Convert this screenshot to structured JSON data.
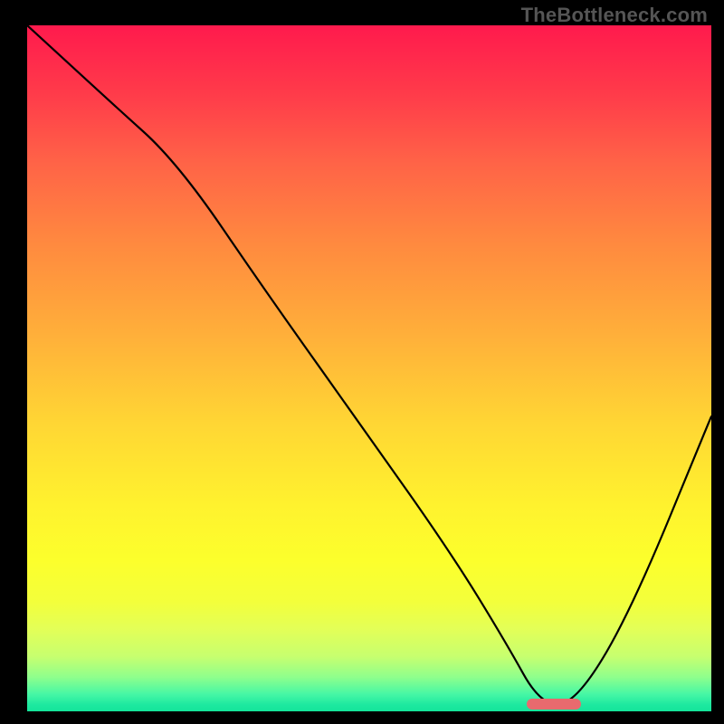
{
  "watermark": "TheBottleneck.com",
  "chart_data": {
    "type": "line",
    "title": "",
    "xlabel": "",
    "ylabel": "",
    "xlim": [
      0,
      100
    ],
    "ylim": [
      0,
      100
    ],
    "background_gradient": {
      "top_color": "#ff1a4d",
      "mid_color": "#ffd634",
      "bottom_color": "#14e49a",
      "meaning": "red=high bottleneck, green=optimal"
    },
    "series": [
      {
        "name": "bottleneck-curve",
        "x": [
          0,
          12,
          22,
          35,
          50,
          62,
          70,
          75,
          80,
          88,
          100
        ],
        "y": [
          100,
          89,
          80,
          61,
          40,
          23,
          10,
          1,
          1,
          14,
          43
        ]
      }
    ],
    "marker": {
      "name": "optimal-range",
      "x_start": 73,
      "x_end": 81,
      "y": 1,
      "color": "#e86a6e"
    }
  }
}
